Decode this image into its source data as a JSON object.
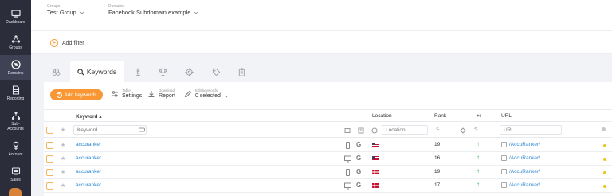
{
  "sidebar": {
    "items": [
      {
        "label": "Dashboard",
        "icon": "monitor-icon"
      },
      {
        "label": "Groups",
        "icon": "groups-icon"
      },
      {
        "label": "Domains",
        "icon": "domains-icon",
        "active": true
      },
      {
        "label": "Reporting",
        "icon": "report-icon"
      },
      {
        "label": "Sub-\nAccounts",
        "icon": "subaccounts-icon"
      },
      {
        "label": "Account",
        "icon": "account-icon"
      },
      {
        "label": "Sales",
        "icon": "sales-icon"
      }
    ]
  },
  "header": {
    "groups_label": "Groups",
    "groups_value": "Test Group",
    "domains_label": "Domains",
    "domains_value": "Facebook Subdomain example"
  },
  "filter": {
    "add_label": "Add filter"
  },
  "tabs": [
    {
      "icon": "binoculars-icon"
    },
    {
      "label": "Keywords",
      "icon": "search-icon",
      "active": true
    },
    {
      "icon": "chess-icon"
    },
    {
      "icon": "trophy-icon"
    },
    {
      "icon": "target-icon"
    },
    {
      "icon": "tag-icon"
    },
    {
      "icon": "clipboard-icon"
    }
  ],
  "toolbar": {
    "add_keywords": "Add keywords",
    "table_small": "Table",
    "table_main": "Settings",
    "download_small": "Download",
    "download_main": "Report",
    "edit_small": "Edit keywords",
    "edit_main": "0 selected"
  },
  "table": {
    "headers": {
      "keyword": "Keyword ▴",
      "location": "Location",
      "rank": "Rank",
      "change": "+/-",
      "url": "URL"
    },
    "filters": {
      "keyword_placeholder": "Keyword",
      "location_placeholder": "Location",
      "url_placeholder": "URL"
    },
    "rows": [
      {
        "keyword": "accuranker",
        "device": "mobile",
        "flag": "us",
        "rank": "19",
        "url": "/AccuRanker/"
      },
      {
        "keyword": "accuranker",
        "device": "desktop",
        "flag": "us",
        "rank": "16",
        "url": "/AccuRanker/"
      },
      {
        "keyword": "accuranker",
        "device": "mobile",
        "flag": "dk",
        "rank": "19",
        "url": "/AccuRanker/"
      },
      {
        "keyword": "accuranker",
        "device": "desktop",
        "flag": "dk",
        "rank": "17",
        "url": "/AccuRanker/"
      }
    ]
  },
  "colors": {
    "accent": "#f89734",
    "sidebar": "#2b2d3b",
    "link": "#2d87d3",
    "up": "#2eae59"
  }
}
